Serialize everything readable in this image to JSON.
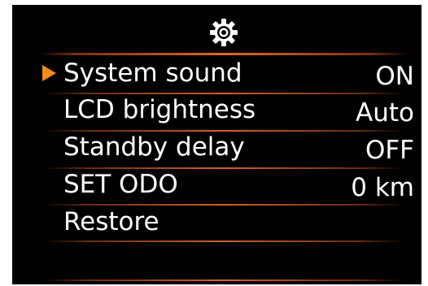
{
  "header": {
    "icon": "gear-icon"
  },
  "menu": {
    "cursor_icon": "triangle-right-icon",
    "cursor_color": "#f28a1a",
    "divider_color": "#d4622a",
    "selected_index": 0,
    "items": [
      {
        "label": "System sound",
        "value": "ON"
      },
      {
        "label": "LCD brightness",
        "value": "Auto"
      },
      {
        "label": "Standby delay",
        "value": "OFF"
      },
      {
        "label": "SET ODO",
        "value": "0 km"
      },
      {
        "label": "Restore",
        "value": ""
      }
    ]
  }
}
